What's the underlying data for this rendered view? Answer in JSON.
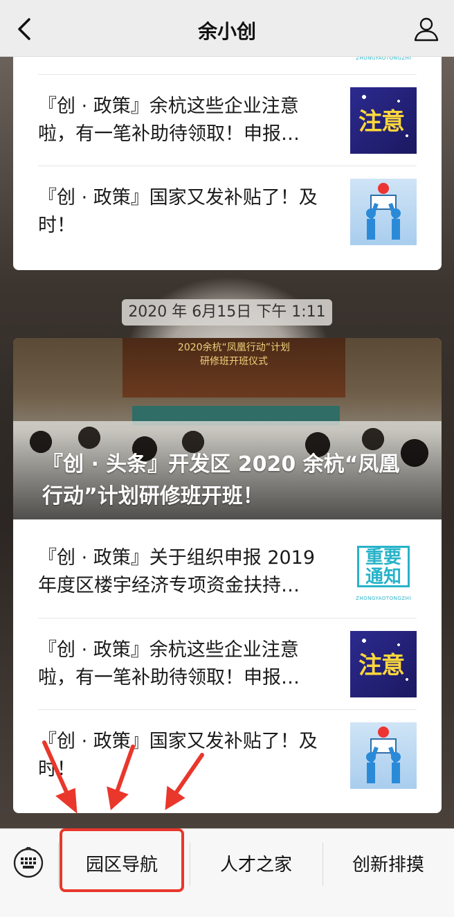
{
  "navbar": {
    "title": "余小创"
  },
  "top_card": {
    "partial_caption": "ZHONGYAOTONGZHI",
    "items": [
      {
        "text": "『创 · 政策』余杭这些企业注意啦，有一笔补助待领取！申报…",
        "thumb": "注意"
      },
      {
        "text": "『创 · 政策』国家又发补贴了！及时！",
        "thumb": ""
      }
    ]
  },
  "timestamp": "2020 年 6月15日  下午 1:11",
  "bottom_card": {
    "hero": {
      "screen_title": "2020余杭“凤凰行动”计划\n研修班开班仪式",
      "title": "『创 · 头条』开发区 2020 余杭“凤凰行动”计划研修班开班！"
    },
    "items": [
      {
        "text": "『创 · 政策』关于组织申报 2019 年度区楼宇经济专项资金扶持…",
        "thumb_top": "重要",
        "thumb_bottom": "通知",
        "thumb_caption": "ZHONGYAOTONGZHI"
      },
      {
        "text": "『创 · 政策』余杭这些企业注意啦，有一笔补助待领取！申报…",
        "thumb": "注意"
      },
      {
        "text": "『创 · 政策』国家又发补贴了！及时！",
        "thumb": ""
      }
    ]
  },
  "menu": {
    "items": [
      "园区导航",
      "人才之家",
      "创新排摸"
    ]
  },
  "colors": {
    "highlight": "#e9372b",
    "navbar_bg": "#ededed",
    "menu_bg": "#f7f7f7"
  }
}
